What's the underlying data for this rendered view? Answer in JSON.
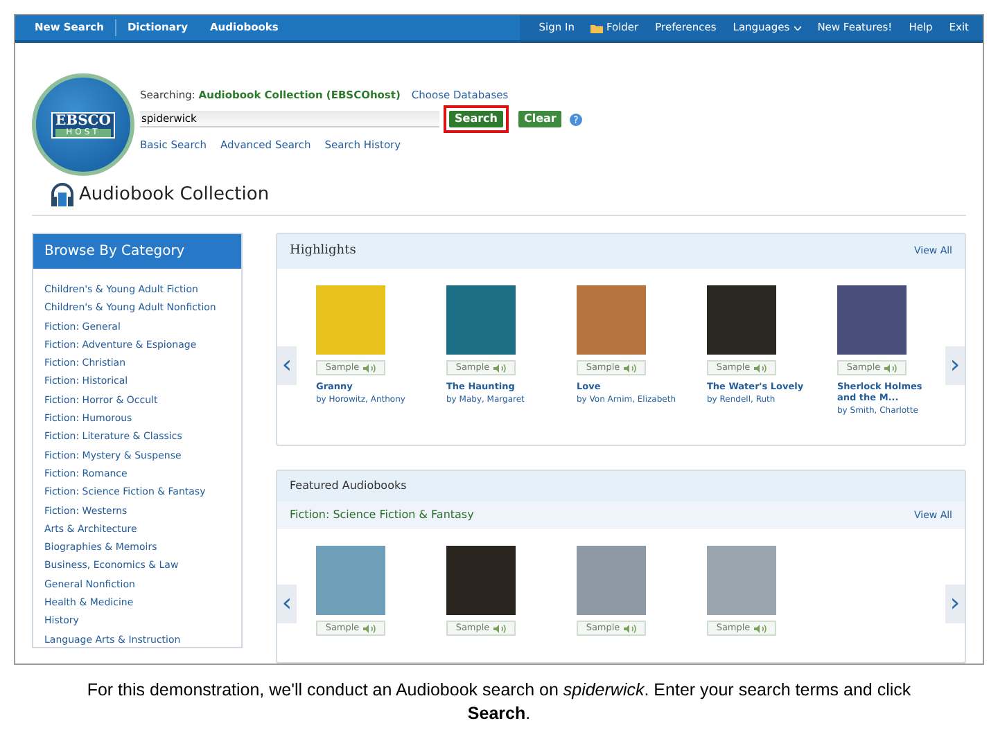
{
  "nav": {
    "left": [
      "New Search",
      "Dictionary",
      "Audiobooks"
    ],
    "right": [
      {
        "label": "Sign In",
        "kind": "link"
      },
      {
        "label": "Folder",
        "kind": "folder"
      },
      {
        "label": "Preferences",
        "kind": "link"
      },
      {
        "label": "Languages",
        "kind": "dropdown"
      },
      {
        "label": "New Features!",
        "kind": "link"
      },
      {
        "label": "Help",
        "kind": "link"
      },
      {
        "label": "Exit",
        "kind": "link"
      }
    ]
  },
  "logo": {
    "top": "EBSCO",
    "bottom": "HOST"
  },
  "search": {
    "searching_label": "Searching:",
    "database": "Audiobook Collection (EBSCOhost)",
    "choose_link": "Choose Databases",
    "value": "spiderwick",
    "buttons": [
      {
        "label": "Search",
        "kind": "primary",
        "highlighted": true
      },
      {
        "label": "Clear",
        "kind": "secondary",
        "highlighted": false
      }
    ],
    "links": [
      "Basic Search",
      "Advanced Search",
      "Search History"
    ],
    "help": "?"
  },
  "collection_title": "Audiobook Collection",
  "browse": {
    "title": "Browse By Category",
    "categories": [
      "Children's & Young Adult Fiction",
      "Children's & Young Adult Nonfiction",
      "Fiction: General",
      "Fiction: Adventure & Espionage",
      "Fiction: Christian",
      "Fiction: Historical",
      "Fiction: Horror & Occult",
      "Fiction: Humorous",
      "Fiction: Literature & Classics",
      "Fiction: Mystery & Suspense",
      "Fiction: Romance",
      "Fiction: Science Fiction & Fantasy",
      "Fiction: Westerns",
      "Arts & Architecture",
      "Biographies & Memoirs",
      "Business, Economics & Law",
      "General Nonfiction",
      "Health & Medicine",
      "History",
      "Language Arts & Instruction"
    ]
  },
  "highlights": {
    "title": "Highlights",
    "view_all": "View All",
    "prev": "‹",
    "next": "›",
    "books": [
      {
        "sample": "Sample",
        "title": "Granny",
        "by": "by",
        "author": "Horowitz, Anthony"
      },
      {
        "sample": "Sample",
        "title": "The Haunting",
        "by": "by",
        "author": "Maby, Margaret"
      },
      {
        "sample": "Sample",
        "title": "Love",
        "by": "by",
        "author": "Von Arnim, Elizabeth"
      },
      {
        "sample": "Sample",
        "title": "The Water's Lovely",
        "by": "by",
        "author": "Rendell, Ruth"
      },
      {
        "sample": "Sample",
        "title": "Sherlock Holmes and the M...",
        "by": "by",
        "author": "Smith, Charlotte"
      }
    ]
  },
  "featured": {
    "title": "Featured Audiobooks",
    "subtitle": "Fiction: Science Fiction & Fantasy",
    "view_all": "View All",
    "prev": "‹",
    "next": "›",
    "books": [
      {
        "sample": "Sample"
      },
      {
        "sample": "Sample"
      },
      {
        "sample": "Sample"
      },
      {
        "sample": "Sample"
      }
    ]
  },
  "caption": "For this demonstration, we'll conduct an Audiobook search on *spiderwick*. Enter your search terms and click **Search**."
}
